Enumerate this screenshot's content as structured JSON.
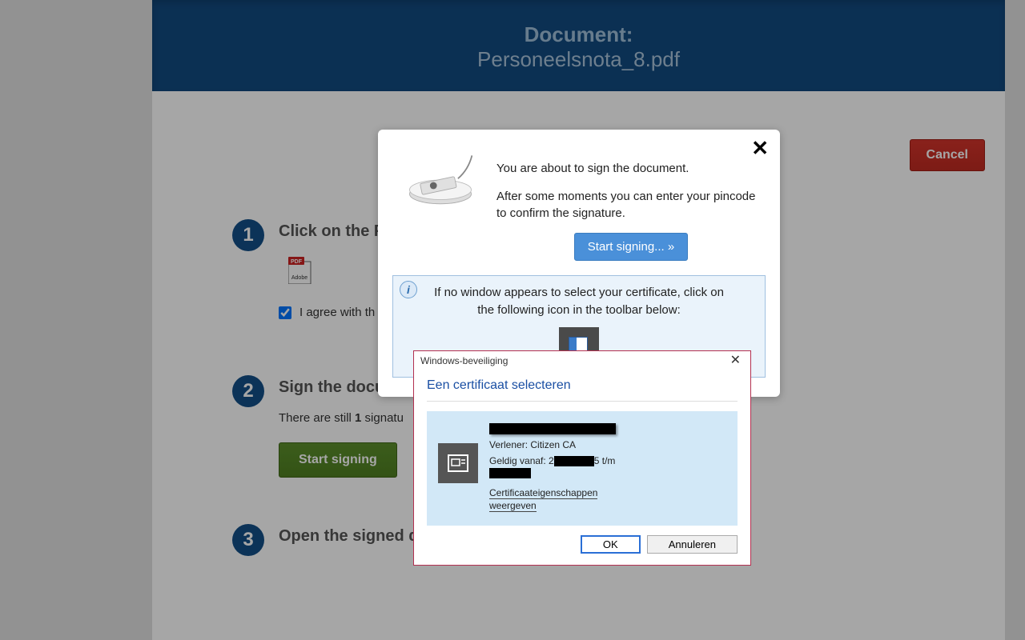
{
  "header": {
    "title_prefix": "Document:",
    "filename": "Personeelsnota_8.pdf"
  },
  "buttons": {
    "cancel": "Cancel"
  },
  "steps": {
    "s1": {
      "num": "1",
      "title": "Click on the P",
      "agree_label": "I agree with th"
    },
    "s2": {
      "num": "2",
      "title": "Sign the docu",
      "sig_prefix": "There are still ",
      "sig_count": "1",
      "sig_suffix": " signatu",
      "start_label": "Start signing"
    },
    "s3": {
      "num": "3",
      "title": "Open the signed do"
    }
  },
  "dialog1": {
    "p1": "You are about to sign the document.",
    "p2": "After some moments you can enter your pincode to confirm the signature.",
    "start_label": "Start signing... »",
    "info": "If no window appears to select your certificate, click on the following icon in the toolbar below:"
  },
  "dialog2": {
    "head": "Windows-beveiliging",
    "title": "Een certificaat selecteren",
    "issuer_label": "Verlener: ",
    "issuer_value": "Citizen CA",
    "valid_label": "Geldig vanaf: ",
    "valid_mid": "2",
    "valid_mid2": "5 t/m",
    "props_link_l1": "Certificaateigenschappen",
    "props_link_l2": "weergeven",
    "ok": "OK",
    "cancel": "Annuleren"
  }
}
